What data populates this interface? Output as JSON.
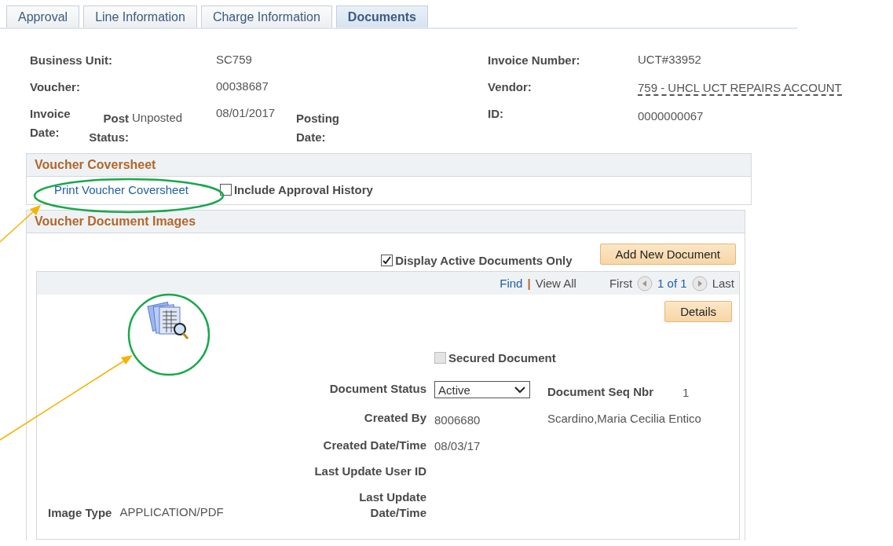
{
  "tabs": [
    {
      "label": "Approval",
      "selected": false
    },
    {
      "label": "Line Information",
      "selected": false
    },
    {
      "label": "Charge Information",
      "selected": false
    },
    {
      "label": "Documents",
      "selected": true
    }
  ],
  "header": {
    "business_unit": {
      "label": "Business Unit:",
      "value": "SC759"
    },
    "voucher": {
      "label": "Voucher:",
      "value": "00038687"
    },
    "invoice_date": {
      "label": "Invoice Date:",
      "value": "08/01/2017"
    },
    "post_status": {
      "label": "Post Status:",
      "value": "Unposted"
    },
    "posting_date": {
      "label": "Posting Date:"
    },
    "invoice_number": {
      "label": "Invoice Number:",
      "value": "UCT#33952"
    },
    "vendor": {
      "label": "Vendor:",
      "value": "759 - UHCL UCT REPAIRS ACCOUNT"
    },
    "id": {
      "label": "ID:",
      "value": "0000000067"
    }
  },
  "coversheet": {
    "title": "Voucher Coversheet",
    "link": "Print Voucher Coversheet",
    "include_history": {
      "label": "Include Approval History",
      "checked": false
    }
  },
  "images": {
    "title": "Voucher Document Images",
    "active_only": {
      "label": "Display Active Documents Only",
      "checked": true
    },
    "add_button": "Add New Document",
    "nav": {
      "find": "Find",
      "separator": "|",
      "view_all": "View All",
      "first": "First",
      "position": "1 of 1",
      "last": "Last"
    },
    "details_button": "Details",
    "secured": {
      "label": "Secured Document",
      "checked": false,
      "disabled": true
    },
    "document_status": {
      "label": "Document Status",
      "value": "Active"
    },
    "seq_nbr": {
      "label": "Document Seq Nbr",
      "value": "1"
    },
    "created_by": {
      "label": "Created By",
      "value": "8006680",
      "name": "Scardino,Maria Cecilia Entico"
    },
    "created_datetime": {
      "label": "Created Date/Time",
      "value": "08/03/17"
    },
    "last_update_user": {
      "label": "Last Update User ID"
    },
    "last_update_datetime": {
      "label": "Last Update Date/Time"
    },
    "image_type": {
      "label": "Image Type",
      "value": "APPLICATION/PDF"
    }
  }
}
